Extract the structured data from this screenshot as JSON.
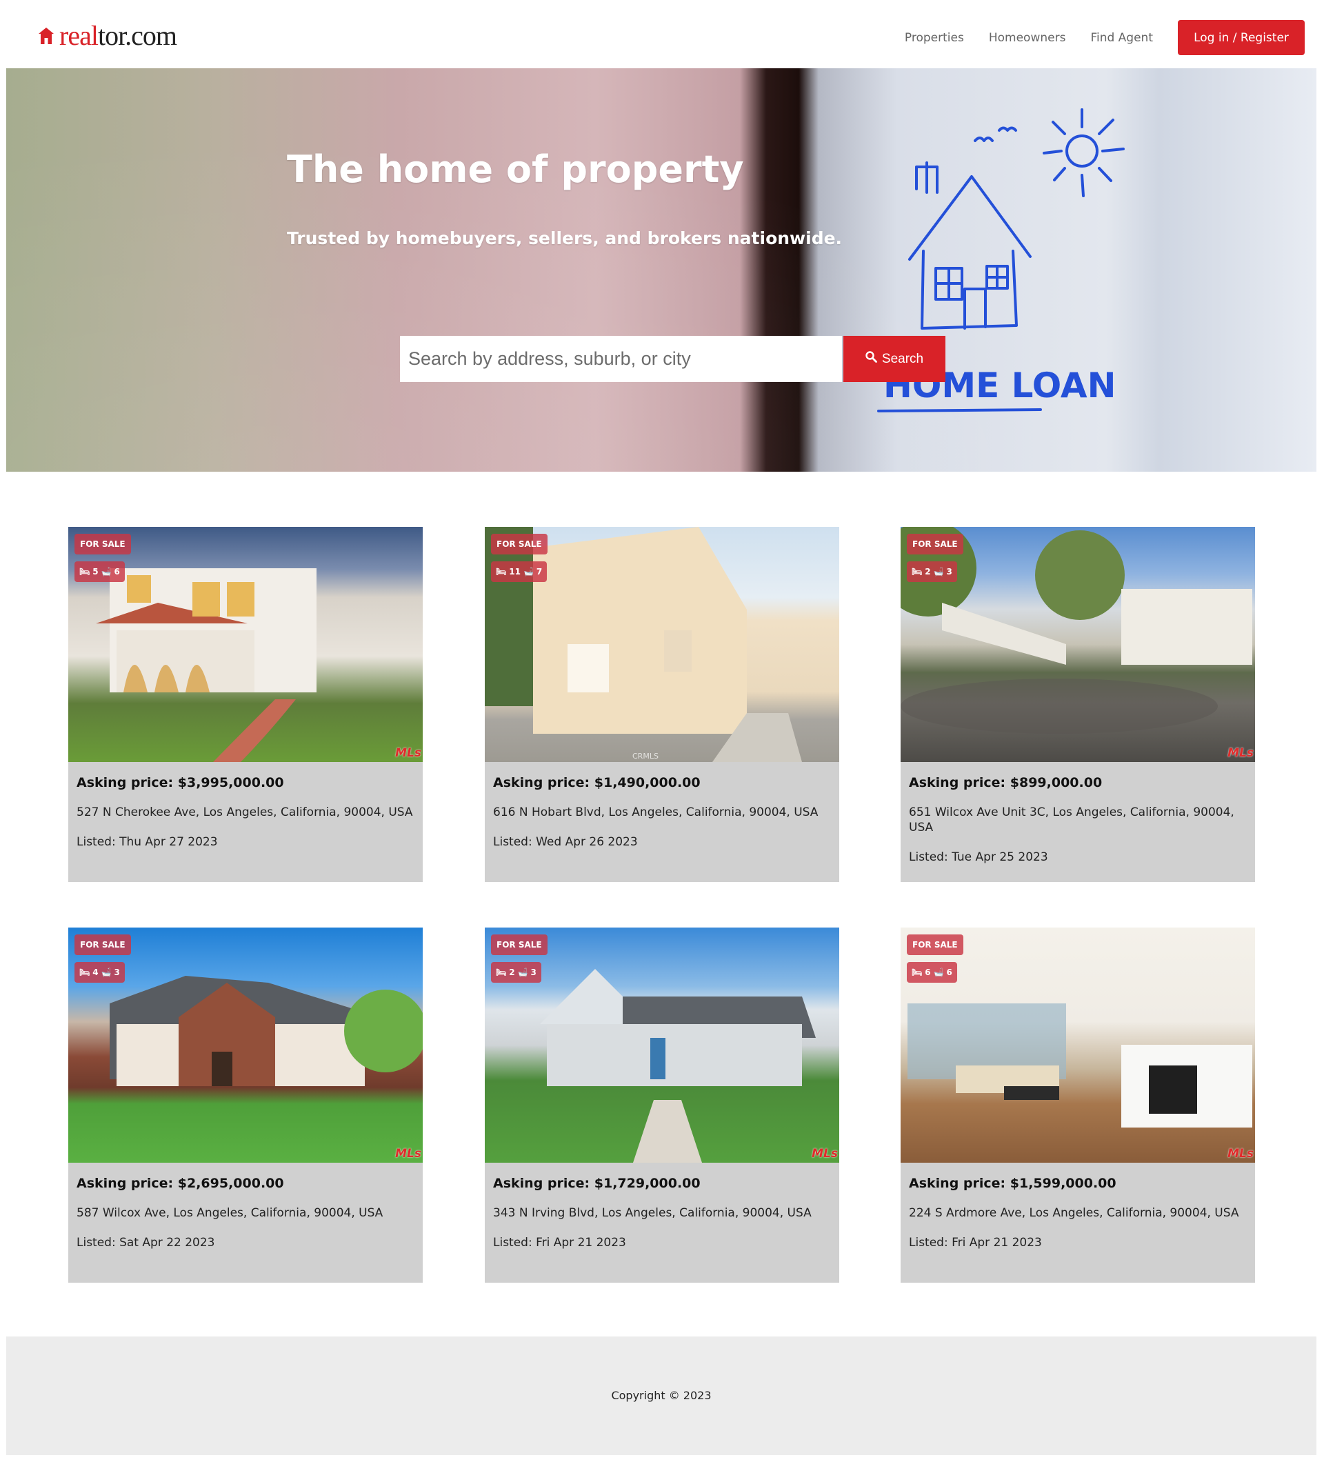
{
  "header": {
    "logo_text_red": "real",
    "logo_text_dark": "tor.com",
    "nav": [
      "Properties",
      "Homeowners",
      "Find Agent"
    ],
    "login_label": "Log in / Register"
  },
  "hero": {
    "title": "The home of property",
    "subtitle": "Trusted by homebuyers, sellers, and brokers nationwide.",
    "search_placeholder": "Search by address, suburb, or city",
    "search_button": "Search",
    "doodle_text": "HOME LOAN"
  },
  "listings": [
    {
      "status": "FOR SALE",
      "beds": "5",
      "baths": "6",
      "price": "Asking price: $3,995,000.00",
      "address": "527 N Cherokee Ave, Los Angeles, California, 90004, USA",
      "listed": "Listed: Thu Apr 27 2023",
      "mls": "MLs"
    },
    {
      "status": "FOR SALE",
      "beds": "11",
      "baths": "7",
      "price": "Asking price: $1,490,000.00",
      "address": "616 N Hobart Blvd, Los Angeles, California, 90004, USA",
      "listed": "Listed: Wed Apr 26 2023",
      "watermark": "CRMLS"
    },
    {
      "status": "FOR SALE",
      "beds": "2",
      "baths": "3",
      "price": "Asking price: $899,000.00",
      "address": "651 Wilcox Ave Unit 3C, Los Angeles, California, 90004, USA",
      "listed": "Listed: Tue Apr 25 2023",
      "mls": "MLs"
    },
    {
      "status": "FOR SALE",
      "beds": "4",
      "baths": "3",
      "price": "Asking price: $2,695,000.00",
      "address": "587 Wilcox Ave, Los Angeles, California, 90004, USA",
      "listed": "Listed: Sat Apr 22 2023",
      "mls": "MLs"
    },
    {
      "status": "FOR SALE",
      "beds": "2",
      "baths": "3",
      "price": "Asking price: $1,729,000.00",
      "address": "343 N Irving Blvd, Los Angeles, California, 90004, USA",
      "listed": "Listed: Fri Apr 21 2023",
      "mls": "MLs"
    },
    {
      "status": "FOR SALE",
      "beds": "6",
      "baths": "6",
      "price": "Asking price: $1,599,000.00",
      "address": "224 S Ardmore Ave, Los Angeles, California, 90004, USA",
      "listed": "Listed: Fri Apr 21 2023",
      "mls": "MLs"
    }
  ],
  "footer": {
    "copyright": "Copyright © 2023"
  },
  "colors": {
    "brand_red": "#d92228",
    "card_bg": "#d0d0d0",
    "footer_bg": "#ececec"
  }
}
